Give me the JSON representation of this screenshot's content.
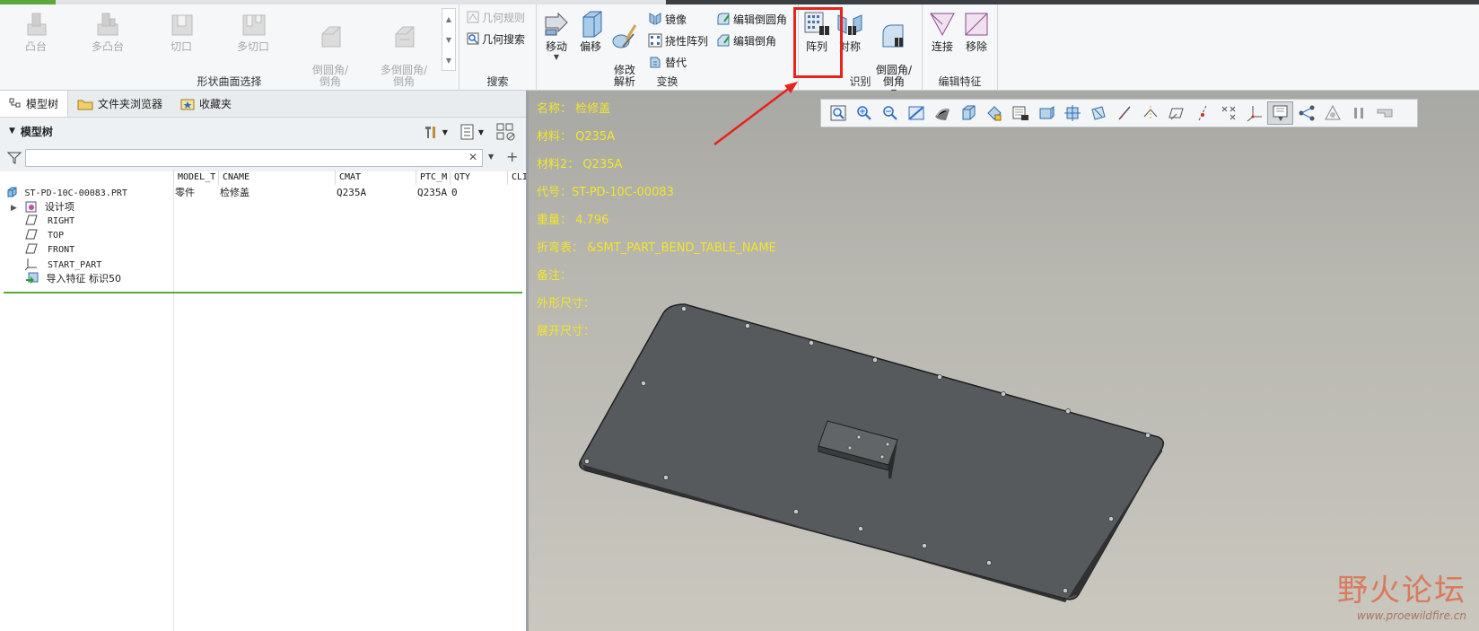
{
  "ribbon": {
    "shape_group": {
      "label": "形状曲面选择",
      "buttons": [
        "凸台",
        "多凸台",
        "切口",
        "多切口",
        "倒圆角/\n倒角",
        "多倒圆角/\n倒角"
      ]
    },
    "search_group": {
      "label": "搜索",
      "rules": "几何规则",
      "search": "几何搜索"
    },
    "transform_group": {
      "label": "变换",
      "move": "移动",
      "offset": "偏移",
      "modify": "修改\n解析",
      "mirror": "镜像",
      "flex_pattern": "挠性阵列",
      "replace": "替代",
      "edit_round": "编辑倒圆角",
      "edit_chamfer": "编辑倒角"
    },
    "recognize_group": {
      "label": "识别",
      "pattern": "阵列",
      "symmetry": "对称",
      "round_chamfer": "倒圆角/\n倒角"
    },
    "edit_feature_group": {
      "label": "编辑特征",
      "connect": "连接",
      "remove": "移除"
    }
  },
  "left_panel": {
    "tabs": [
      "模型树",
      "文件夹浏览器",
      "收藏夹"
    ],
    "tree_title": "模型树",
    "filter_placeholder": "",
    "columns": [
      "MODEL_T",
      "CNAME",
      "CMAT",
      "PTC_M",
      "QTY",
      "CLI"
    ],
    "root": {
      "name": "ST-PD-10C-00083.PRT",
      "model_type": "零件",
      "cname": "检修盖",
      "cmat": "Q235A",
      "ptc_mat": "Q235A",
      "qty": "0"
    },
    "items": [
      {
        "label": "设计项",
        "icon": "design-items-icon"
      },
      {
        "label": "RIGHT",
        "icon": "datum-plane-icon"
      },
      {
        "label": "TOP",
        "icon": "datum-plane-icon"
      },
      {
        "label": "FRONT",
        "icon": "datum-plane-icon"
      },
      {
        "label": "START_PART",
        "icon": "coordinate-system-icon"
      },
      {
        "label": "导入特征 标识50",
        "icon": "import-feature-icon"
      }
    ]
  },
  "viewport": {
    "annotations": [
      {
        "key": "名称：",
        "value": "检修盖"
      },
      {
        "key": "材料：",
        "value": "Q235A"
      },
      {
        "key": "材料2：",
        "value": "Q235A"
      },
      {
        "key": "代号：",
        "value": "ST-PD-10C-00083"
      },
      {
        "key": "重量：",
        "value": "4.796"
      },
      {
        "key": "折弯表：",
        "value": "&SMT_PART_BEND_TABLE_NAME"
      },
      {
        "key": "备注：",
        "value": ""
      },
      {
        "key": "外形尺寸：",
        "value": ""
      },
      {
        "key": "展开尺寸：",
        "value": ""
      }
    ],
    "watermark": {
      "title": "野火论坛",
      "url": "www.proewildfire.cn"
    }
  },
  "colors": {
    "annotation": "#f2e62a",
    "highlight": "#e8231b",
    "accent": "#5aa839"
  }
}
